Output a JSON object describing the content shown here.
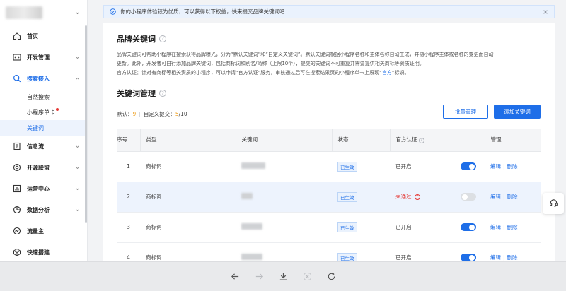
{
  "notice": {
    "text": "你的小程序体验较为优质，可以获得以下权益，快来提交品牌关键词吧"
  },
  "sidebar": {
    "items": [
      {
        "label": "首页",
        "icon": "home-icon"
      },
      {
        "label": "开发管理",
        "icon": "code-icon"
      },
      {
        "label": "搜索接入",
        "icon": "search-icon",
        "active": true
      },
      {
        "label": "信息流",
        "icon": "feed-icon"
      },
      {
        "label": "开源联盟",
        "icon": "alliance-icon"
      },
      {
        "label": "运营中心",
        "icon": "chart-icon"
      },
      {
        "label": "数据分析",
        "icon": "pie-icon"
      },
      {
        "label": "流量主",
        "icon": "traffic-icon"
      },
      {
        "label": "快速搭建",
        "icon": "cube-icon"
      }
    ],
    "sub_items": [
      {
        "label": "自然搜索"
      },
      {
        "label": "小程序单卡"
      },
      {
        "label": "关键词"
      }
    ]
  },
  "brand": {
    "title": "品牌关键词",
    "desc_line1": "品牌关键词可帮助小程序在搜索获得品牌曝光，分为“默认关键词”和“自定义关键词”。默认关键词根据小程序名称和主体名称自动生成，并随小程序主体或名称的变更而自动",
    "desc_line2": "更新。此外，开发者可自行添加品牌关键词，包括商标词和别名/简称（上限10个），提交的关键词不可重复并需要提供相关商标等资质证明。",
    "desc_line3_a": "官方认证：针对有商标等相关资质的小程序，可以申请“官方认证”服务，审核通过后可在搜索结果页的小程序单卡上展现“",
    "desc_line3_hl": "官方",
    "desc_line3_b": "”标识。"
  },
  "manage": {
    "title": "关键词管理",
    "default_label": "默认：",
    "default_count": "9",
    "custom_label": "自定义提交：",
    "custom_count": "5",
    "custom_total": "/10",
    "batch_button": "批量管理",
    "add_button": "添加关键词"
  },
  "table": {
    "headers": [
      "序号",
      "类型",
      "关键词",
      "状态",
      "官方认证",
      "管理"
    ],
    "rows": [
      {
        "index": "1",
        "type": "商标词",
        "status": "已生效",
        "auth": "已开启",
        "auth_failed": false,
        "toggle_on": true,
        "edit": "编辑",
        "delete": "删除"
      },
      {
        "index": "2",
        "type": "商标词",
        "status": "已生效",
        "auth": "未通过",
        "auth_failed": true,
        "toggle_on": false,
        "edit": "编辑",
        "delete": "删除"
      },
      {
        "index": "3",
        "type": "商标词",
        "status": "已生效",
        "auth": "已开启",
        "auth_failed": false,
        "toggle_on": true,
        "edit": "编辑",
        "delete": "删除"
      },
      {
        "index": "4",
        "type": "商标词",
        "status": "已生效",
        "auth": "已开启",
        "auth_failed": false,
        "toggle_on": true,
        "edit": "编辑",
        "delete": "删除"
      }
    ]
  },
  "colors": {
    "accent": "#1e6ee8",
    "danger": "#e53935",
    "count": "#f0a020"
  }
}
